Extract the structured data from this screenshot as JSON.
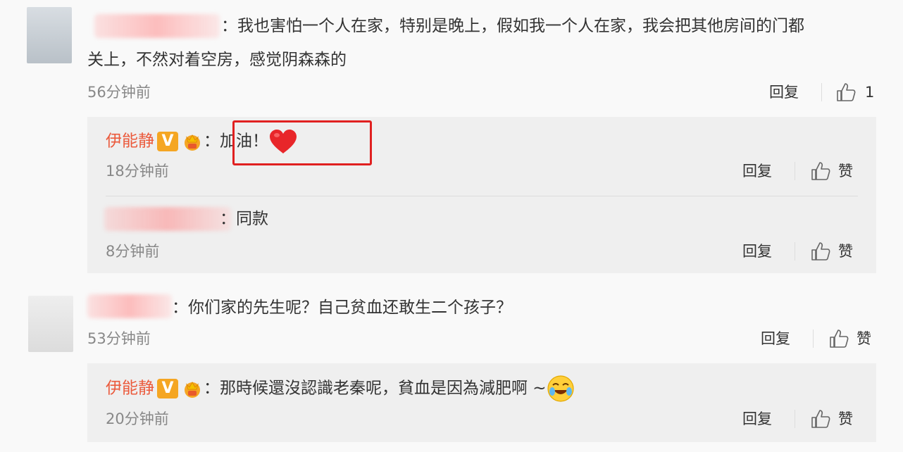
{
  "comments": [
    {
      "text_line1": "：我也害怕一个人在家，特别是晚上，假如我一个人在家，我会把其他房间的门都",
      "text_line2": "关上，不然对着空房，感觉阴森森的",
      "time": "56分钟前",
      "reply_label": "回复",
      "like_count": "1",
      "replies": [
        {
          "author": "伊能静",
          "badge_v": "V",
          "text": "：加油！",
          "time": "18分钟前",
          "reply_label": "回复",
          "like_label": "赞"
        },
        {
          "text": "：同款",
          "time": "8分钟前",
          "reply_label": "回复",
          "like_label": "赞"
        }
      ]
    },
    {
      "text": "：你们家的先生呢？自己贫血还敢生二个孩子？",
      "time": "53分钟前",
      "reply_label": "回复",
      "like_label": "赞",
      "replies": [
        {
          "author": "伊能静",
          "badge_v": "V",
          "text": "：那時候還沒認識老秦呢，貧血是因為減肥啊 ~",
          "time": "20分钟前",
          "reply_label": "回复",
          "like_label": "赞"
        }
      ]
    }
  ],
  "colors": {
    "author_name": "#eb5a3c",
    "highlight": "#e02020",
    "badge_v": "#f5a623",
    "reply_bg": "#efefef"
  }
}
